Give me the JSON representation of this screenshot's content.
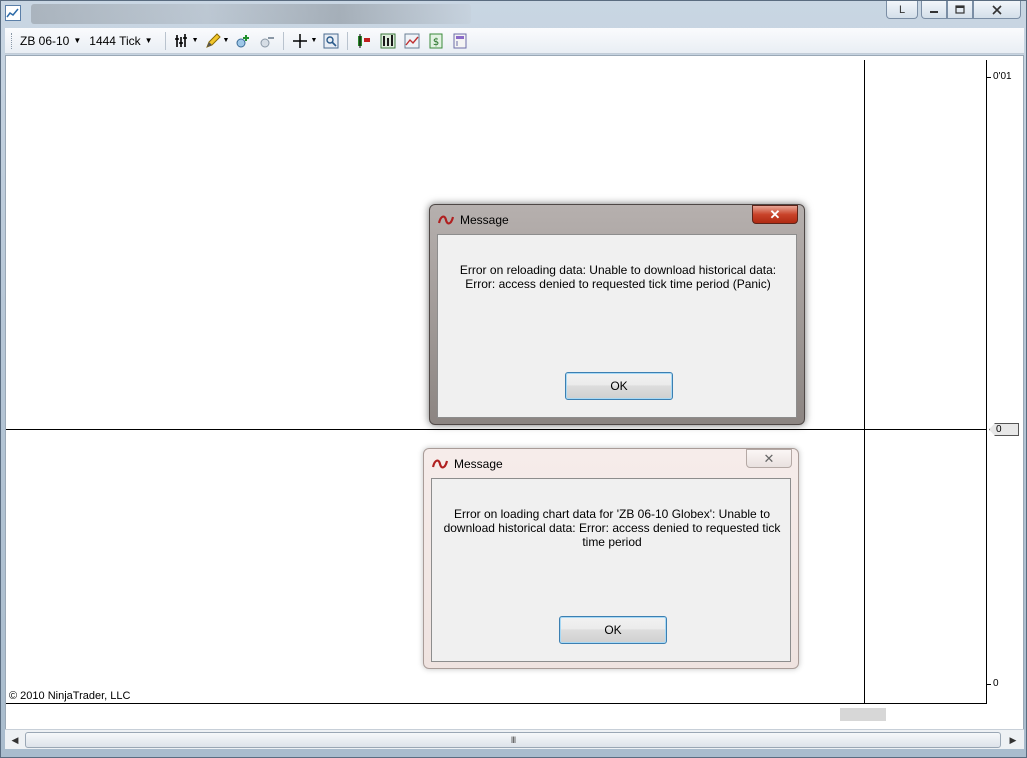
{
  "window": {
    "l_button": "L"
  },
  "toolbar": {
    "instrument": "ZB 06-10",
    "interval": "1444 Tick"
  },
  "chart": {
    "axis_top_label": "0'01",
    "axis_bottom_label": "0",
    "price_marker": "0",
    "copyright": "© 2010 NinjaTrader, LLC"
  },
  "scrollbar": {
    "grip": "III"
  },
  "dialogs": [
    {
      "title": "Message",
      "message": "Error on reloading data: Unable to download historical data: Error: access denied to requested tick time period (Panic)",
      "ok_label": "OK"
    },
    {
      "title": "Message",
      "message": "Error on loading chart data for 'ZB 06-10 Globex': Unable to download historical data: Error: access denied to requested tick time period",
      "ok_label": "OK"
    }
  ],
  "colors": {
    "close_active": "#c9432a",
    "ok_border": "#3c7fb1"
  }
}
